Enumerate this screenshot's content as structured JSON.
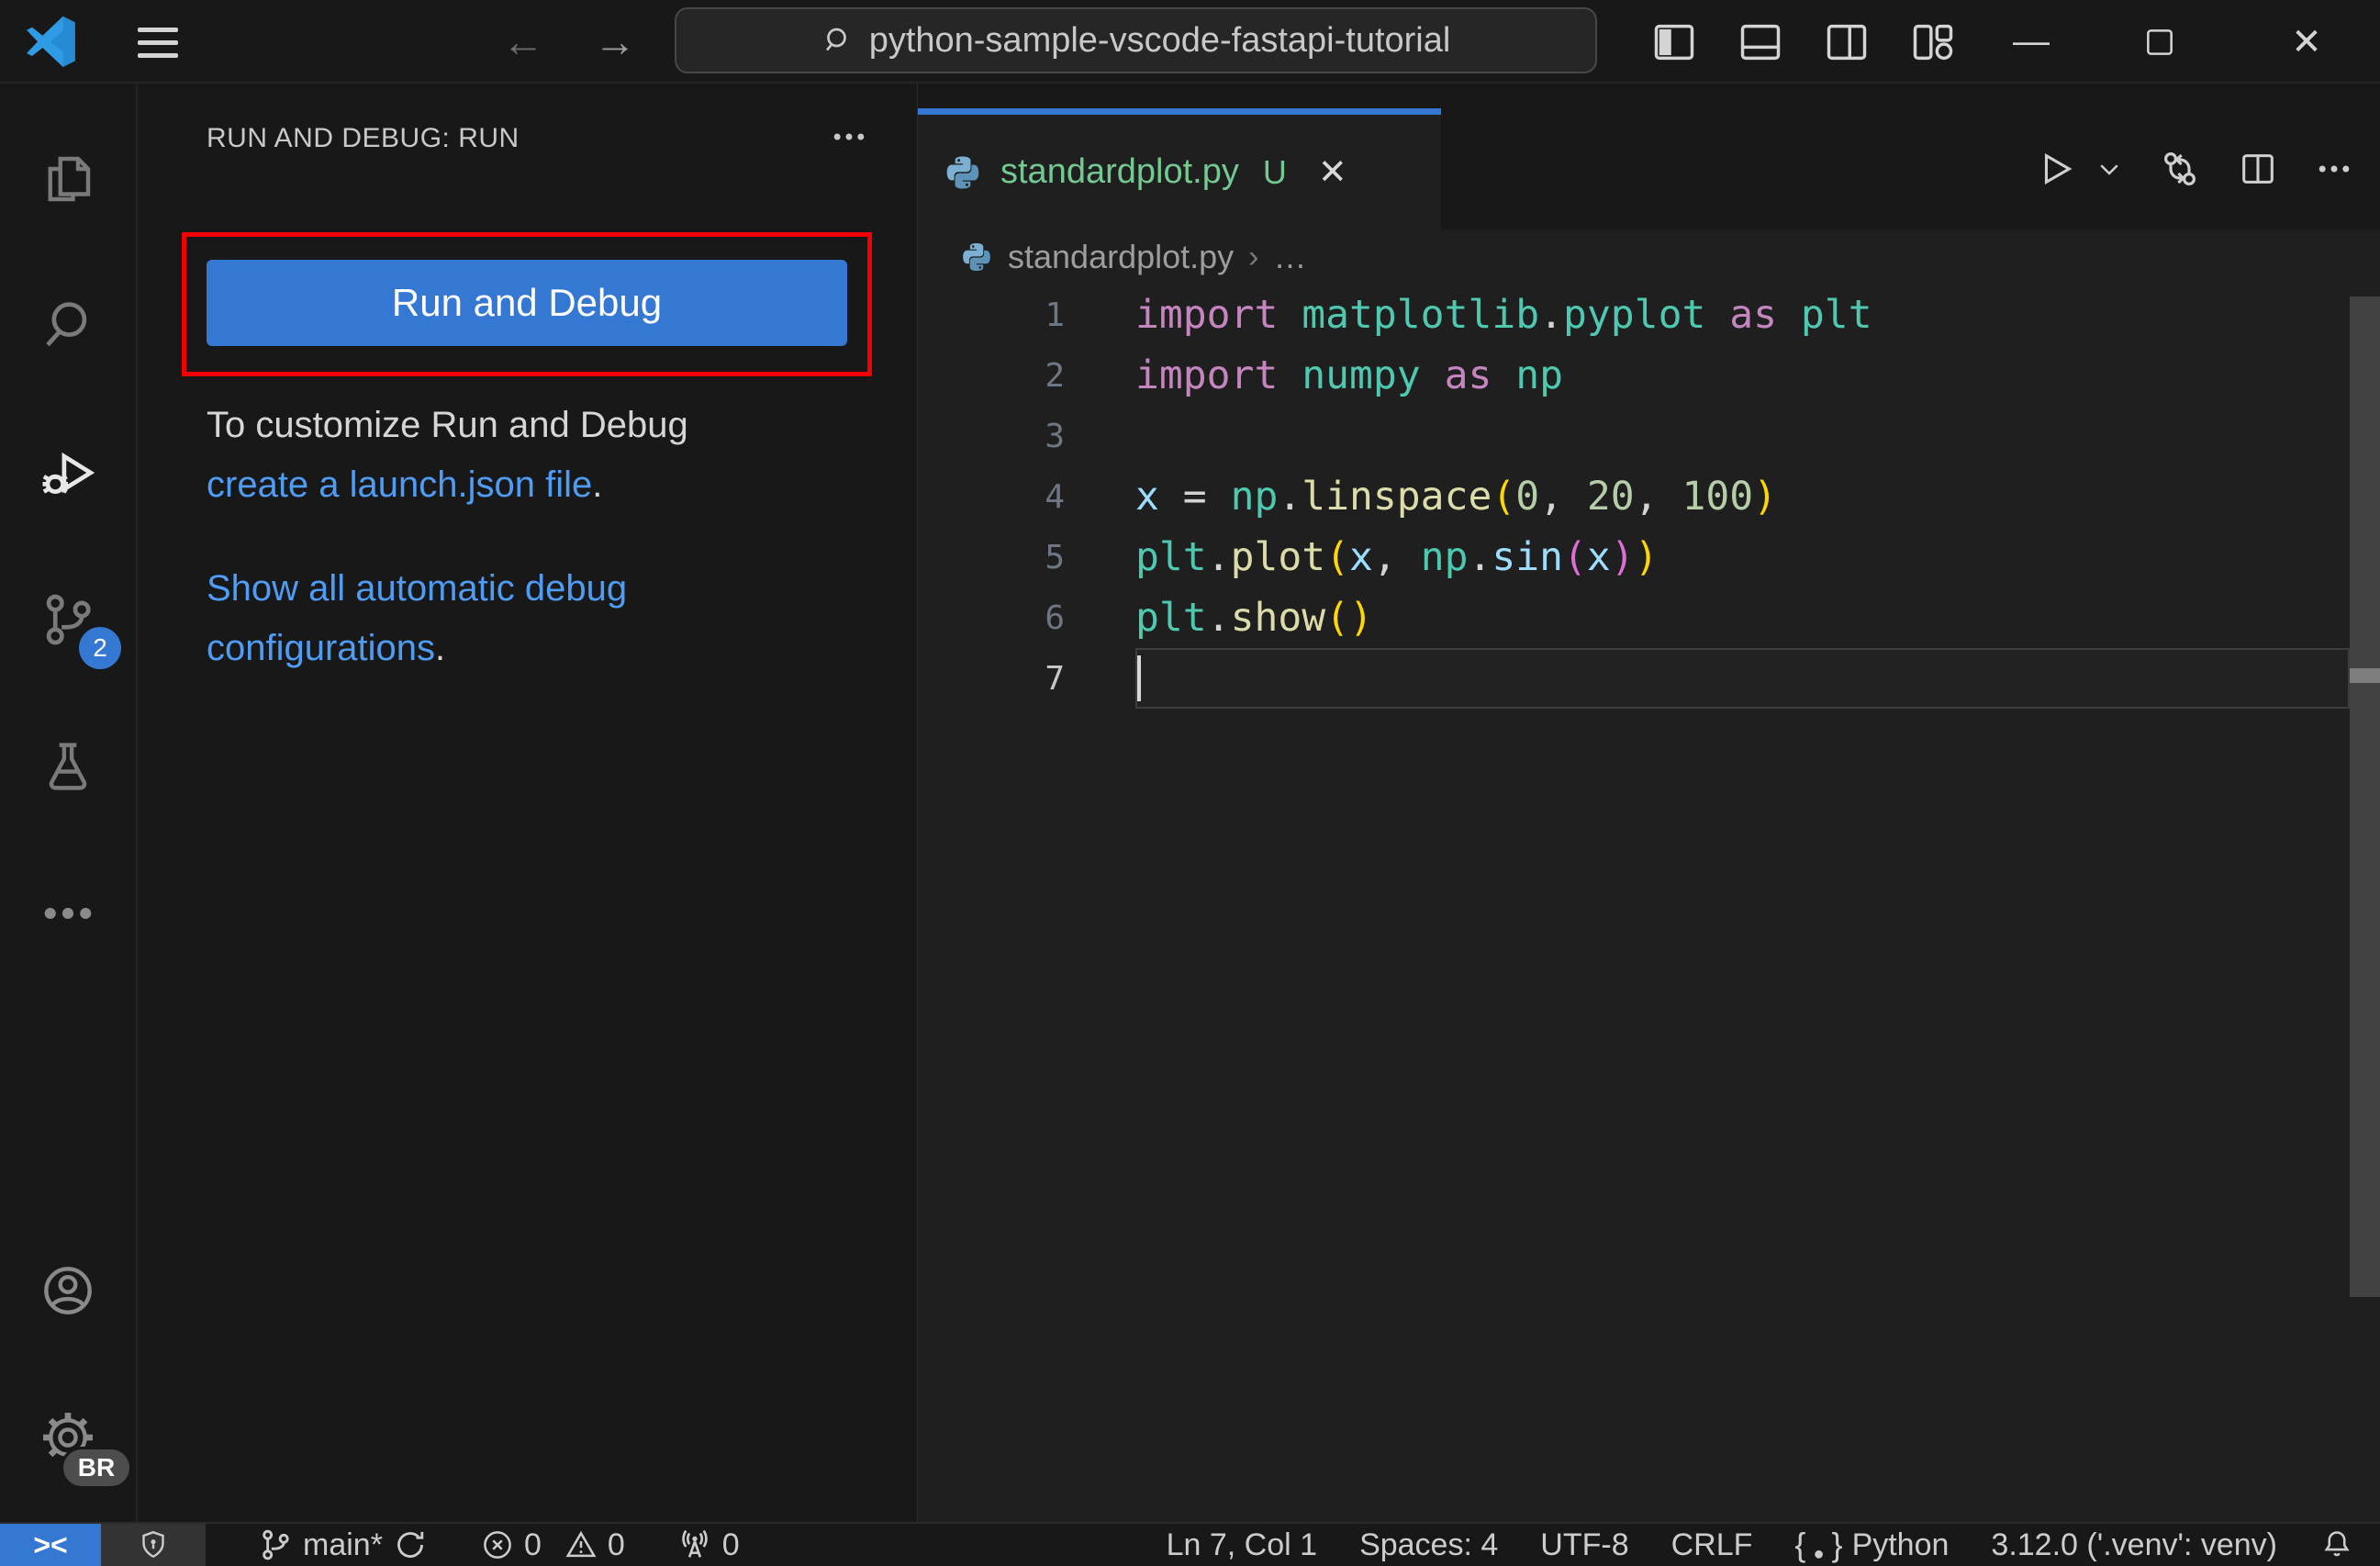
{
  "colors": {
    "accent": "#3478d4",
    "untracked": "#73c991",
    "link": "#4f9cf5",
    "highlight_red": "#f10000"
  },
  "window": {
    "search_value": "python-sample-vscode-fastapi-tutorial"
  },
  "icons": [
    "vscode-logo",
    "menu",
    "arrow-left",
    "arrow-right",
    "search",
    "panel-left",
    "panel-bottom",
    "panel-right",
    "layout-customize",
    "minimize",
    "maximize",
    "close",
    "files",
    "search-sidebar",
    "run-and-debug",
    "source-control",
    "testing",
    "more",
    "account",
    "settings-gear",
    "ellipsis",
    "run",
    "chevron-down",
    "open-changes",
    "split-editor",
    "python",
    "remote",
    "shield",
    "git-branch",
    "sync",
    "error",
    "warning",
    "radio-tower",
    "braces",
    "bell"
  ],
  "side_panel": {
    "header": "RUN AND DEBUG: RUN",
    "run_button": "Run and Debug",
    "customize_text": "To customize Run and Debug",
    "launch_link": "create a launch.json file",
    "launch_suffix": ".",
    "show_link": "Show all automatic debug configurations",
    "show_suffix": "."
  },
  "activity_bar": {
    "source_control_badge": "2",
    "settings_badge": "BR"
  },
  "editor": {
    "tab_name": "standardplot.py",
    "tab_badge": "U",
    "tab_close": "✕",
    "breadcrumb_file": "standardplot.py",
    "breadcrumb_more": "…",
    "lines": [
      {
        "num": "1",
        "tokens": [
          [
            "kw",
            "import"
          ],
          [
            "op",
            " "
          ],
          [
            "mod",
            "matplotlib"
          ],
          [
            "op",
            "."
          ],
          [
            "mod",
            "pyplot"
          ],
          [
            "op",
            " "
          ],
          [
            "kw",
            "as"
          ],
          [
            "op",
            " "
          ],
          [
            "mod",
            "plt"
          ]
        ]
      },
      {
        "num": "2",
        "tokens": [
          [
            "kw",
            "import"
          ],
          [
            "op",
            " "
          ],
          [
            "mod",
            "numpy"
          ],
          [
            "op",
            " "
          ],
          [
            "kw",
            "as"
          ],
          [
            "op",
            " "
          ],
          [
            "mod",
            "np"
          ]
        ]
      },
      {
        "num": "3",
        "tokens": []
      },
      {
        "num": "4",
        "tokens": [
          [
            "var",
            "x"
          ],
          [
            "op",
            " = "
          ],
          [
            "mod",
            "np"
          ],
          [
            "op",
            "."
          ],
          [
            "fn",
            "linspace"
          ],
          [
            "b1",
            "("
          ],
          [
            "num",
            "0"
          ],
          [
            "op",
            ", "
          ],
          [
            "num",
            "20"
          ],
          [
            "op",
            ", "
          ],
          [
            "num",
            "100"
          ],
          [
            "b1",
            ")"
          ]
        ]
      },
      {
        "num": "5",
        "tokens": [
          [
            "mod",
            "plt"
          ],
          [
            "op",
            "."
          ],
          [
            "fn",
            "plot"
          ],
          [
            "b1",
            "("
          ],
          [
            "var",
            "x"
          ],
          [
            "op",
            ", "
          ],
          [
            "mod",
            "np"
          ],
          [
            "op",
            "."
          ],
          [
            "var",
            "sin"
          ],
          [
            "b2",
            "("
          ],
          [
            "var",
            "x"
          ],
          [
            "b2",
            ")"
          ],
          [
            "b1",
            ")"
          ]
        ]
      },
      {
        "num": "6",
        "tokens": [
          [
            "mod",
            "plt"
          ],
          [
            "op",
            "."
          ],
          [
            "fn",
            "show"
          ],
          [
            "b1",
            "("
          ],
          [
            "b1",
            ")"
          ]
        ]
      },
      {
        "num": "7",
        "tokens": [],
        "current": true
      }
    ]
  },
  "status_bar": {
    "remote": "><",
    "branch": "main*",
    "errors": "0",
    "warnings": "0",
    "ports": "0",
    "line_col": "Ln 7, Col 1",
    "indent": "Spaces: 4",
    "encoding": "UTF-8",
    "eol": "CRLF",
    "language": "Python",
    "interpreter": "3.12.0 ('.venv': venv)"
  }
}
